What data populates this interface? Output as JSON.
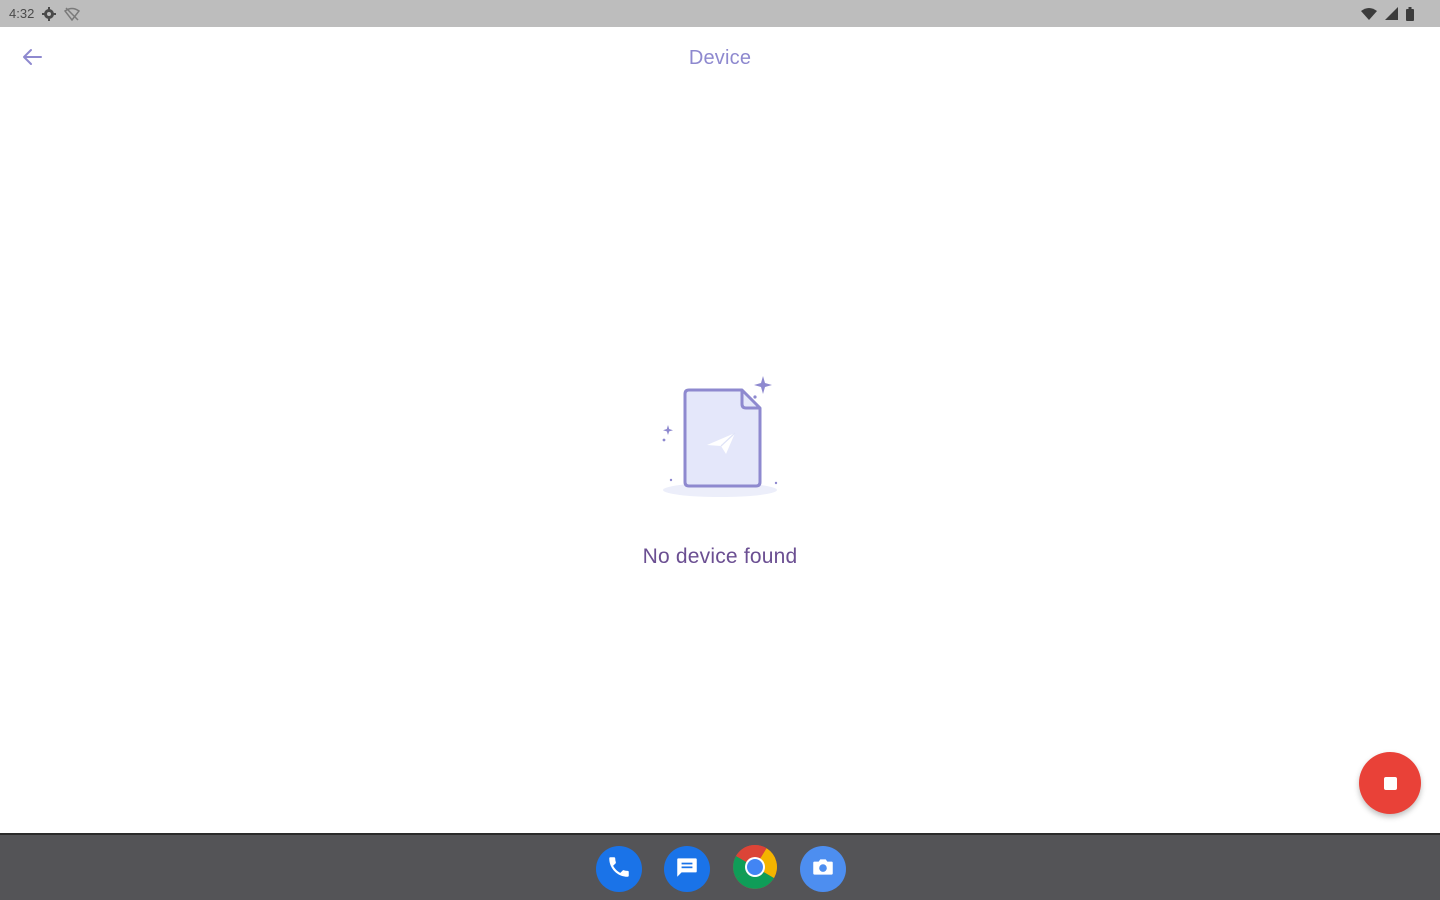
{
  "status_bar": {
    "time": "4:32",
    "icons_left": [
      "settings-gear-icon",
      "wifi-off-icon"
    ],
    "icons_right": [
      "wifi-icon",
      "cell-signal-icon",
      "battery-icon"
    ]
  },
  "app_bar": {
    "title": "Device",
    "back_icon": "arrow-back-icon"
  },
  "empty_state": {
    "message": "No device found",
    "illustration_icon": "document-send-icon"
  },
  "fab": {
    "icon": "stop-icon"
  },
  "dock": {
    "apps": [
      "phone-icon",
      "messages-icon",
      "chrome-icon",
      "camera-icon"
    ]
  },
  "colors": {
    "accent": "#8e89cf",
    "text_purple": "#6b4f92",
    "fab_red": "#e94138",
    "status_bar": "#bdbdbd",
    "nav_bar": "#545457"
  }
}
